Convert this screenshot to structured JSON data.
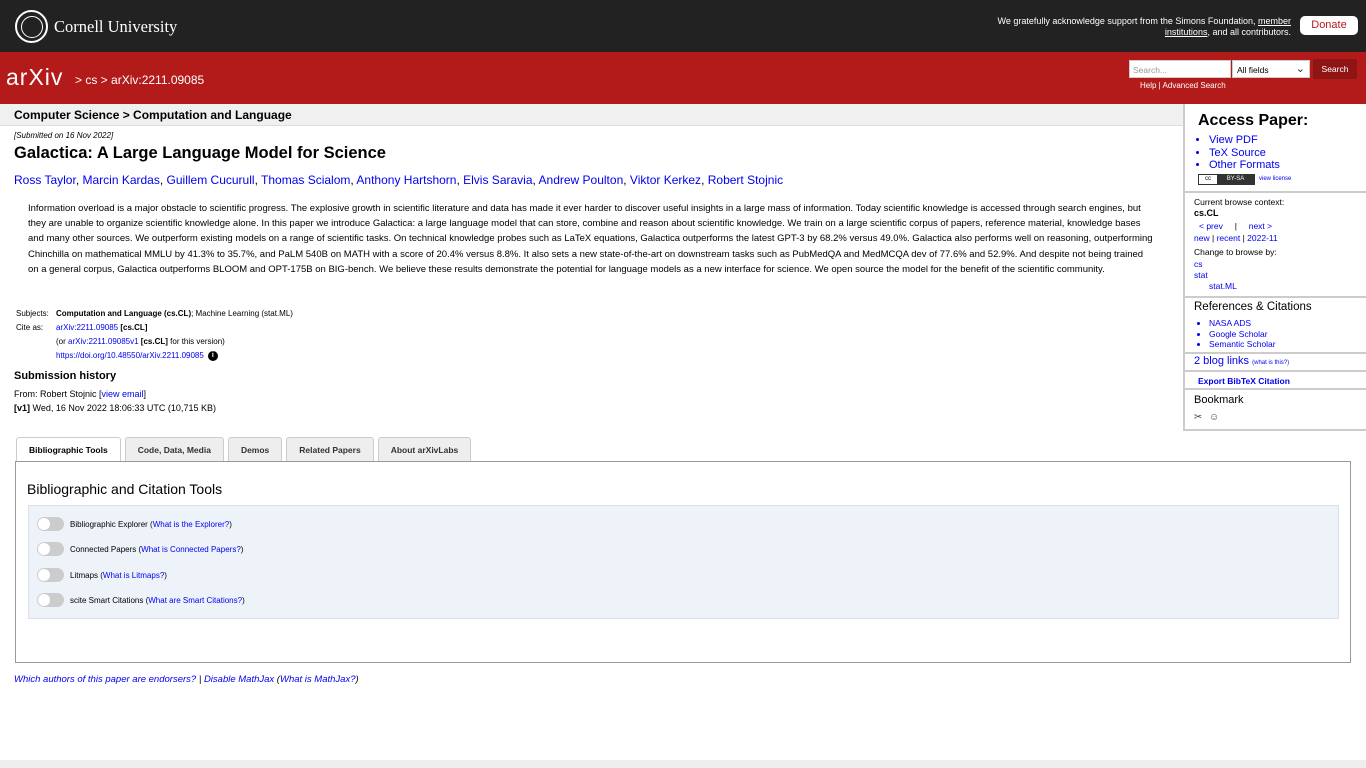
{
  "cornell": {
    "name": "Cornell University",
    "support_text_pre": "We gratefully acknowledge support from the Simons Foundation, ",
    "support_link": "member institutions",
    "support_text_post": ", and all contributors.",
    "donate": "Donate"
  },
  "header": {
    "logo": "arXiv",
    "breadcrumb": "> cs > arXiv:2211.09085",
    "search_placeholder": "Search...",
    "field_select": "All fields",
    "search_button": "Search",
    "help": "Help",
    "advanced_search": "Advanced Search"
  },
  "subject_header": "Computer Science > Computation and Language",
  "paper": {
    "submitted": "[Submitted on 16 Nov 2022]",
    "title": "Galactica: A Large Language Model for Science",
    "authors": [
      "Ross Taylor",
      "Marcin Kardas",
      "Guillem Cucurull",
      "Thomas Scialom",
      "Anthony Hartshorn",
      "Elvis Saravia",
      "Andrew Poulton",
      "Viktor Kerkez",
      "Robert Stojnic"
    ],
    "abstract": "Information overload is a major obstacle to scientific progress. The explosive growth in scientific literature and data has made it ever harder to discover useful insights in a large mass of information. Today scientific knowledge is accessed through search engines, but they are unable to organize scientific knowledge alone. In this paper we introduce Galactica: a large language model that can store, combine and reason about scientific knowledge. We train on a large scientific corpus of papers, reference material, knowledge bases and many other sources. We outperform existing models on a range of scientific tasks. On technical knowledge probes such as LaTeX equations, Galactica outperforms the latest GPT-3 by 68.2% versus 49.0%. Galactica also performs well on reasoning, outperforming Chinchilla on mathematical MMLU by 41.3% to 35.7%, and PaLM 540B on MATH with a score of 20.4% versus 8.8%. It also sets a new state-of-the-art on downstream tasks such as PubMedQA and MedMCQA dev of 77.6% and 52.9%. And despite not being trained on a general corpus, Galactica outperforms BLOOM and OPT-175B on BIG-bench. We believe these results demonstrate the potential for language models as a new interface for science. We open source the model for the benefit of the scientific community."
  },
  "meta": {
    "subjects_label": "Subjects:",
    "subjects_primary": "Computation and Language (cs.CL)",
    "subjects_secondary": "; Machine Learning (stat.ML)",
    "cite_label": "Cite as:",
    "cite_id": "arXiv:2211.09085",
    "cite_cat": " [cs.CL]",
    "or_pre": "(or ",
    "or_id": "arXiv:2211.09085v1",
    "or_cat": " [cs.CL]",
    "or_post": " for this version)",
    "doi": "https://doi.org/10.48550/arXiv.2211.09085"
  },
  "history": {
    "title": "Submission history",
    "from_pre": "From: Robert Stojnic [",
    "view_email": "view email",
    "from_post": "]",
    "version": "[v1]",
    "version_text": " Wed, 16 Nov 2022 18:06:33 UTC (10,715 KB)"
  },
  "tabs": [
    {
      "label": "Bibliographic Tools"
    },
    {
      "label": "Code, Data, Media"
    },
    {
      "label": "Demos"
    },
    {
      "label": "Related Papers"
    },
    {
      "label": "About arXivLabs"
    }
  ],
  "tools": {
    "title": "Bibliographic and Citation Tools",
    "rows": [
      {
        "label": "Bibliographic Explorer (",
        "link": "What is the Explorer?",
        "end": ")"
      },
      {
        "label": "Connected Papers (",
        "link": "What is Connected Papers?",
        "end": ")"
      },
      {
        "label": "Litmaps (",
        "link": "What is Litmaps?",
        "end": ")"
      },
      {
        "label": "scite Smart Citations (",
        "link": "What are Smart Citations?",
        "end": ")"
      }
    ]
  },
  "footer": {
    "endorsers": "Which authors of this paper are endorsers?",
    "sep": " | ",
    "disable_mathjax": "Disable MathJax",
    "what_mathjax_pre": " (",
    "what_mathjax": "What is MathJax?",
    "what_mathjax_post": ")"
  },
  "sidebar": {
    "access_title": "Access Paper:",
    "access_links": [
      "View PDF",
      "TeX Source",
      "Other Formats"
    ],
    "license_left": "cc",
    "license_right": "BY-SA",
    "view_license": "view license",
    "context_title": "Current browse context:",
    "context_current": "cs.CL",
    "prev": "< prev",
    "pipe": "|",
    "next": "next >",
    "new": "new",
    "recent": "recent",
    "month": "2022-11",
    "change_title": "Change to browse by:",
    "change_cs": "cs",
    "change_stat": "stat",
    "change_statml": "stat.ML",
    "refs_title": "References & Citations",
    "refs_links": [
      "NASA ADS",
      "Google Scholar",
      "Semantic Scholar"
    ],
    "blog_links": "2 blog links",
    "blog_what": "(what is this?)",
    "bibtex": "Export BibTeX Citation",
    "bookmark": "Bookmark"
  }
}
